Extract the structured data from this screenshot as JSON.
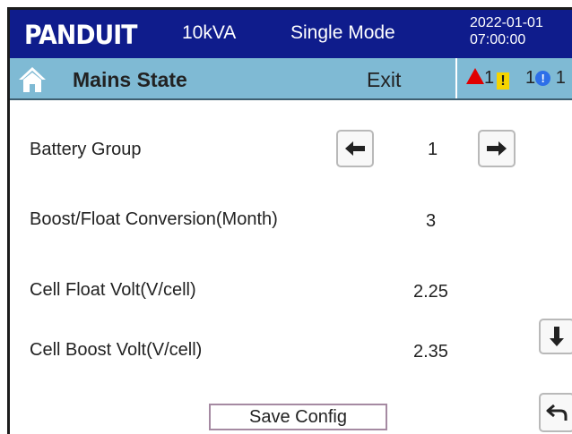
{
  "header": {
    "brand": "PANDUIT",
    "capacity": "10kVA",
    "mode": "Single Mode",
    "date": "2022-01-01",
    "time": "07:00:00"
  },
  "titlebar": {
    "title": "Mains State",
    "exit_label": "Exit",
    "alarms": {
      "critical": "1",
      "warning": "1",
      "info": "1"
    }
  },
  "settings": {
    "battery_group": {
      "label": "Battery Group",
      "value": "1"
    },
    "boost_float": {
      "label": "Boost/Float Conversion(Month)",
      "value": "3"
    },
    "cell_float": {
      "label": "Cell Float Volt(V/cell)",
      "value": "2.25"
    },
    "cell_boost": {
      "label": "Cell Boost Volt(V/cell)",
      "value": "2.35"
    }
  },
  "actions": {
    "save_label": "Save Config"
  },
  "colors": {
    "header_bg": "#0f1c8c",
    "titlebar_bg": "#7fbad4",
    "alarm_critical": "#e00000",
    "alarm_warning": "#f5d400",
    "alarm_info": "#2d6fe8"
  },
  "icons": [
    "home-icon",
    "arrow-left-icon",
    "arrow-right-icon",
    "arrow-down-icon",
    "return-icon"
  ]
}
